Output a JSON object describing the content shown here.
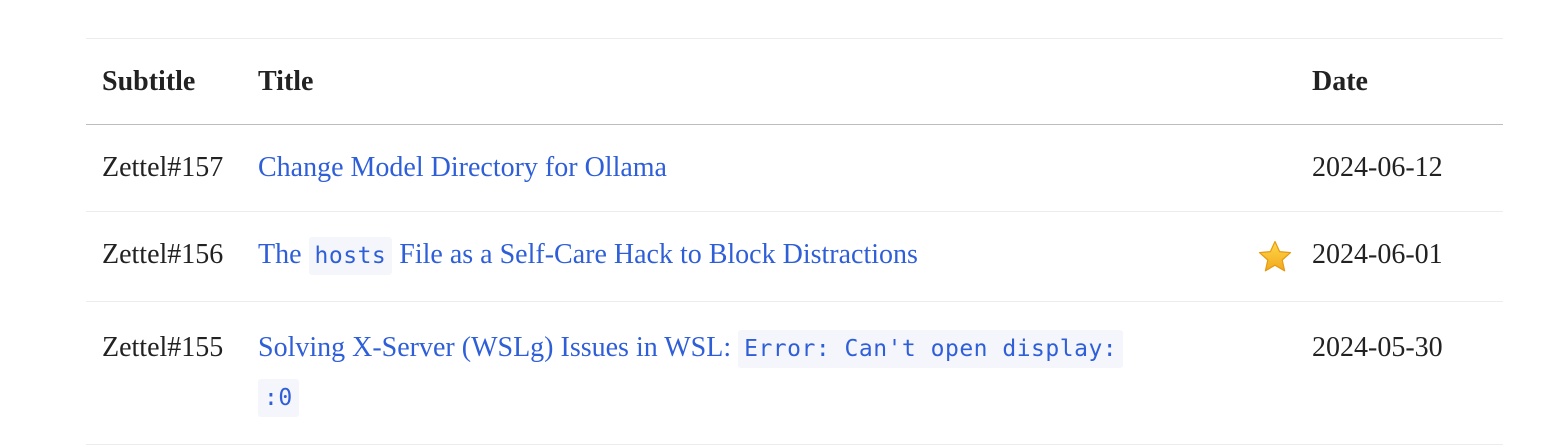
{
  "table": {
    "headers": {
      "subtitle": "Subtitle",
      "title": "Title",
      "date": "Date"
    },
    "rows": [
      {
        "subtitle": "Zettel#157",
        "title_pre": "Change Model Directory for Ollama",
        "title_code": "",
        "title_post": "",
        "starred": false,
        "date": "2024-06-12"
      },
      {
        "subtitle": "Zettel#156",
        "title_pre": "The",
        "title_code": "hosts",
        "title_post": "File as a Self-Care Hack to Block Distractions",
        "starred": true,
        "date": "2024-06-01"
      },
      {
        "subtitle": "Zettel#155",
        "title_pre": "Solving X-Server (WSLg) Issues in WSL:",
        "title_code": "Error: Can't open display:",
        "title_code_2": ":0",
        "starred": false,
        "date": "2024-05-30"
      }
    ],
    "star_icon": "star-icon",
    "link_color": "#2f5fd8"
  }
}
